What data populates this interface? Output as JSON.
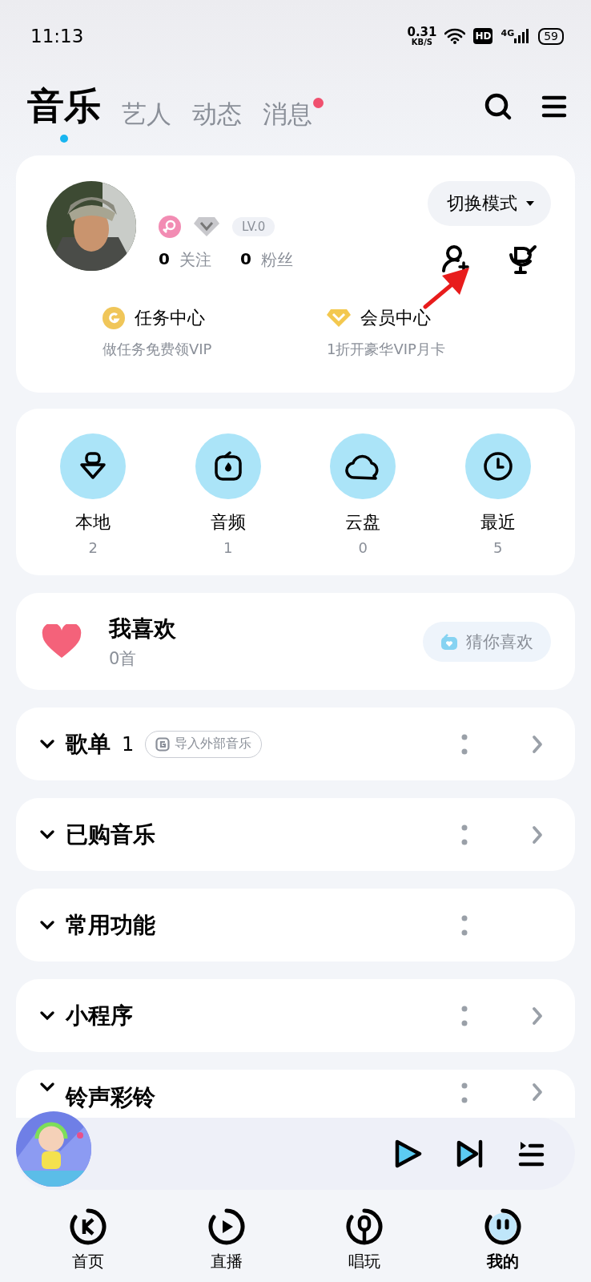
{
  "status_bar": {
    "time": "11:13",
    "net_speed": "0.31",
    "net_unit": "KB/S",
    "hd": "HD",
    "network": "4G",
    "battery": "59"
  },
  "tabs": [
    {
      "label": "音乐",
      "selected": true,
      "dot": false
    },
    {
      "label": "艺人",
      "selected": false,
      "dot": false
    },
    {
      "label": "动态",
      "selected": false,
      "dot": false
    },
    {
      "label": "消息",
      "selected": false,
      "dot": true
    }
  ],
  "profile": {
    "level": "LV.0",
    "mode_button": "切换模式",
    "stats": [
      {
        "count": "0",
        "label": "关注"
      },
      {
        "count": "0",
        "label": "粉丝"
      }
    ],
    "centers": [
      {
        "kind": "coin",
        "title": "任务中心",
        "subtitle": "做任务免费领VIP"
      },
      {
        "kind": "vip",
        "title": "会员中心",
        "subtitle": "1折开豪华VIP月卡"
      }
    ]
  },
  "shortcuts": [
    {
      "kind": "local",
      "label": "本地",
      "count": "2"
    },
    {
      "kind": "audio",
      "label": "音频",
      "count": "1"
    },
    {
      "kind": "cloud",
      "label": "云盘",
      "count": "0"
    },
    {
      "kind": "recent",
      "label": "最近",
      "count": "5"
    }
  ],
  "favorites": {
    "title": "我喜欢",
    "count": "0首",
    "button": "猜你喜欢"
  },
  "sections": [
    {
      "title": "歌单",
      "count": "1",
      "import_button": "导入外部音乐",
      "arrow": true
    },
    {
      "title": "已购音乐",
      "arrow": true
    },
    {
      "title": "常用功能",
      "arrow": false
    },
    {
      "title": "小程序",
      "arrow": true
    },
    {
      "title": "铃声彩铃",
      "arrow": true
    }
  ],
  "nav": [
    {
      "kind": "home",
      "label": "首页",
      "selected": false
    },
    {
      "kind": "live",
      "label": "直播",
      "selected": false
    },
    {
      "kind": "sing",
      "label": "唱玩",
      "selected": false
    },
    {
      "kind": "mine",
      "label": "我的",
      "selected": true
    }
  ]
}
